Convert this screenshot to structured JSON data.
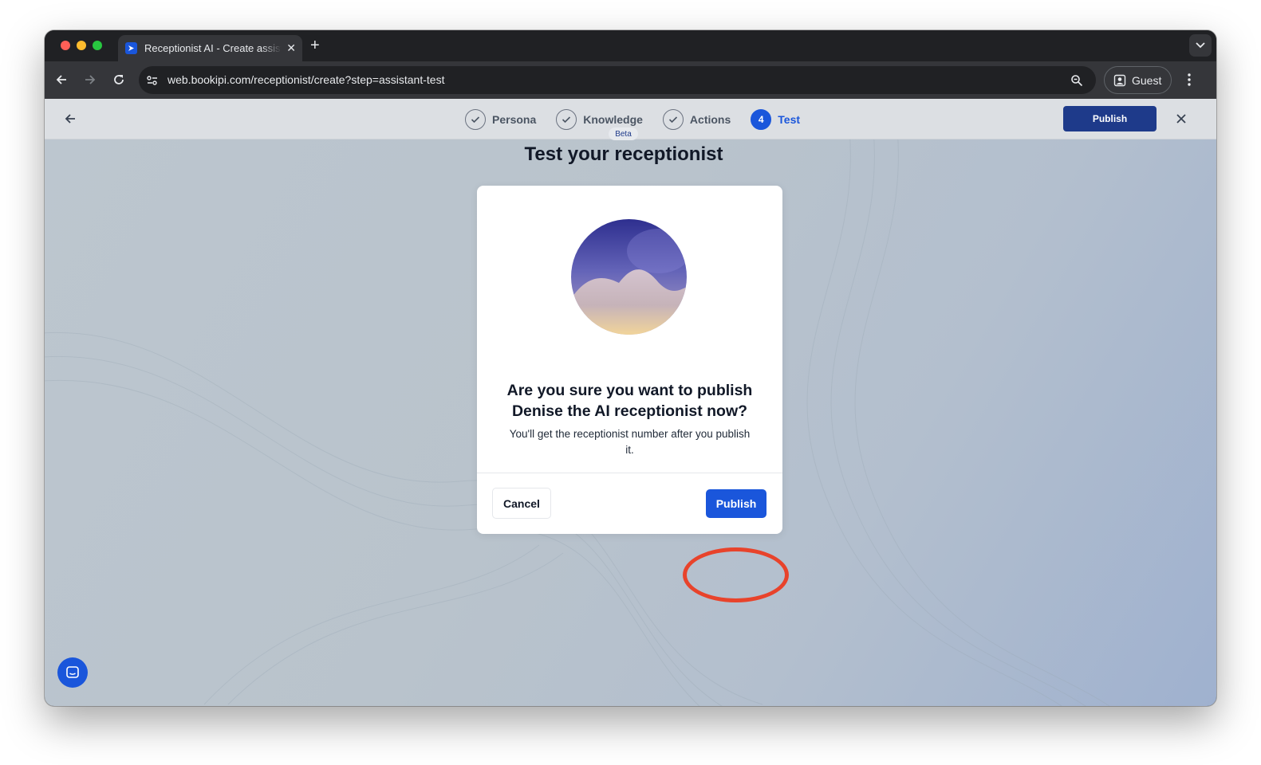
{
  "browser": {
    "tab_title": "Receptionist AI - Create assistant",
    "url": "web.bookipi.com/receptionist/create?step=assistant-test",
    "profile_label": "Guest"
  },
  "stepper": {
    "steps": [
      {
        "label": "Persona",
        "state": "complete"
      },
      {
        "label": "Knowledge",
        "state": "complete"
      },
      {
        "label": "Actions",
        "state": "complete"
      },
      {
        "label": "Test",
        "number": "4",
        "state": "active"
      }
    ],
    "publish_label": "Publish"
  },
  "page": {
    "badge": "Beta",
    "title": "Test your receptionist"
  },
  "modal": {
    "heading": "Are you sure you want to publish Denise the AI receptionist now?",
    "body": "You'll get the receptionist number after you publish it.",
    "cancel_label": "Cancel",
    "publish_label": "Publish"
  },
  "colors": {
    "primary": "#1a56db",
    "primary_dark": "#1e3a8a",
    "highlight": "#e8432b"
  },
  "icons": [
    "back-arrow-icon",
    "forward-arrow-icon",
    "reload-icon",
    "site-settings-icon",
    "zoom-icon",
    "profile-icon",
    "kebab-menu-icon",
    "check-icon",
    "close-icon",
    "chat-icon"
  ]
}
